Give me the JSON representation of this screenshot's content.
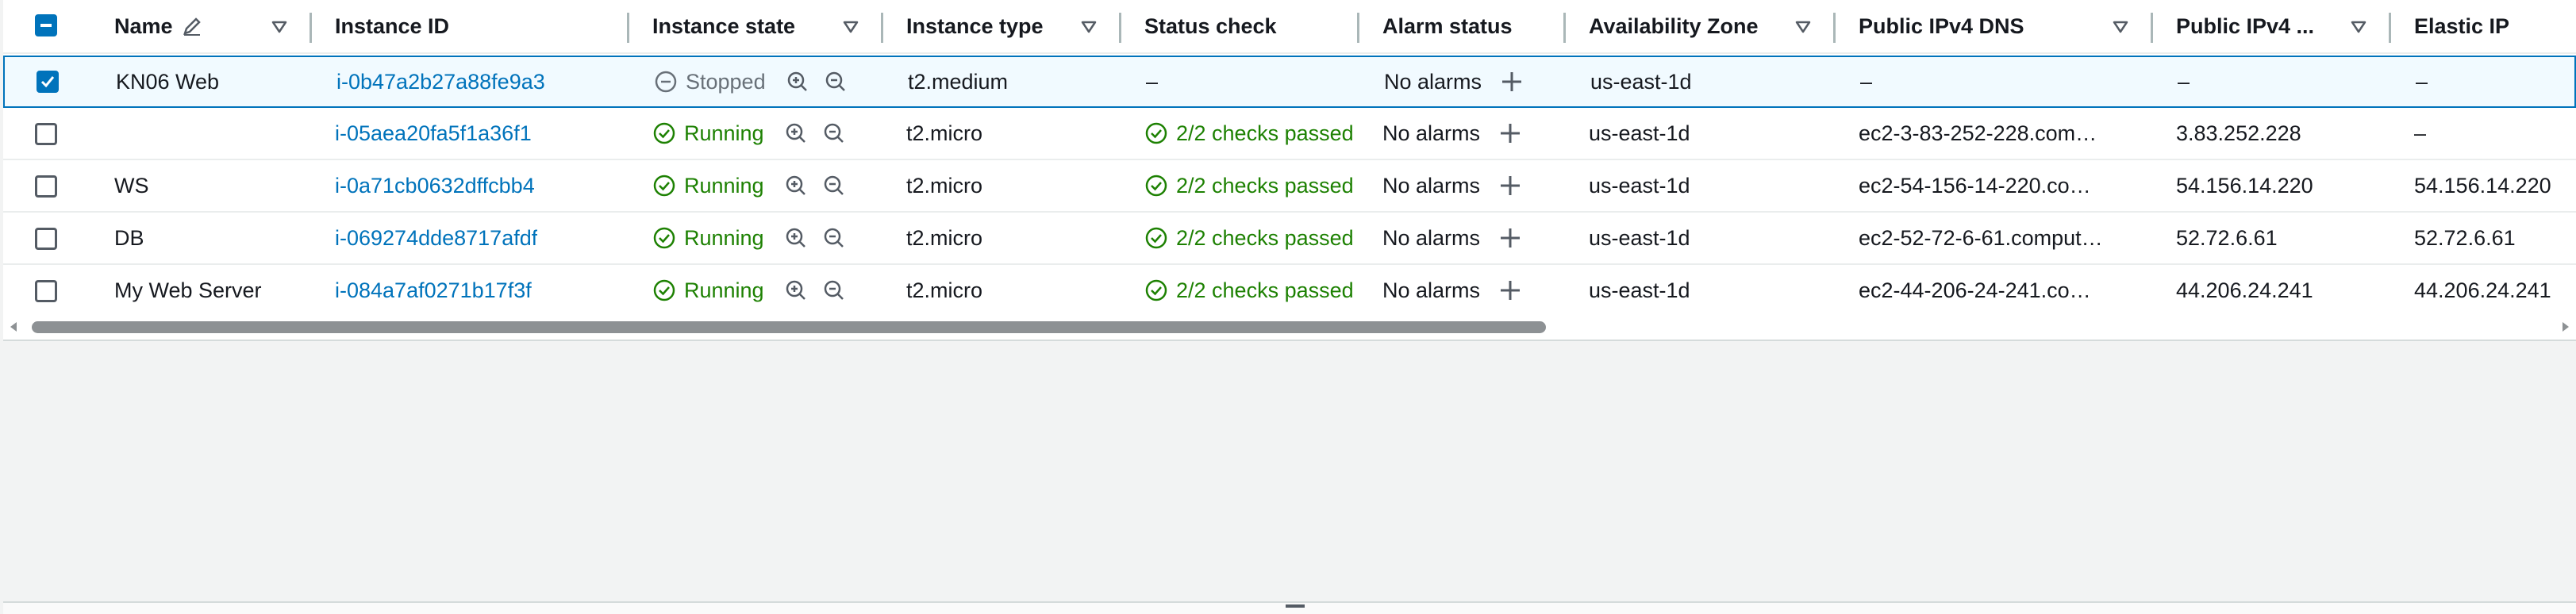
{
  "columns": [
    {
      "label": "Name",
      "edit_icon": "pencil-icon"
    },
    {
      "label": "Instance ID"
    },
    {
      "label": "Instance state"
    },
    {
      "label": "Instance type"
    },
    {
      "label": "Status check"
    },
    {
      "label": "Alarm status"
    },
    {
      "label": "Availability Zone"
    },
    {
      "label": "Public IPv4 DNS"
    },
    {
      "label": "Public IPv4 ..."
    },
    {
      "label": "Elastic IP"
    }
  ],
  "rows": [
    {
      "name": "KN06 Web",
      "id": "i-0b47a2b27a88fe9a3",
      "state": "Stopped",
      "type": "t2.medium",
      "status": "–",
      "alarm": "No alarms",
      "az": "us-east-1d",
      "dns": "–",
      "ipv4": "–",
      "eip": "–",
      "selected": true
    },
    {
      "name": "",
      "id": "i-05aea20fa5f1a36f1",
      "state": "Running",
      "type": "t2.micro",
      "status": "2/2 checks passed",
      "alarm": "No alarms",
      "az": "us-east-1d",
      "dns": "ec2-3-83-252-228.com…",
      "ipv4": "3.83.252.228",
      "eip": "–",
      "selected": false
    },
    {
      "name": "WS",
      "id": "i-0a71cb0632dffcbb4",
      "state": "Running",
      "type": "t2.micro",
      "status": "2/2 checks passed",
      "alarm": "No alarms",
      "az": "us-east-1d",
      "dns": "ec2-54-156-14-220.co…",
      "ipv4": "54.156.14.220",
      "eip": "54.156.14.220",
      "selected": false
    },
    {
      "name": "DB",
      "id": "i-069274dde8717afdf",
      "state": "Running",
      "type": "t2.micro",
      "status": "2/2 checks passed",
      "alarm": "No alarms",
      "az": "us-east-1d",
      "dns": "ec2-52-72-6-61.comput…",
      "ipv4": "52.72.6.61",
      "eip": "52.72.6.61",
      "selected": false
    },
    {
      "name": "My Web Server",
      "id": "i-084a7af0271b17f3f",
      "state": "Running",
      "type": "t2.micro",
      "status": "2/2 checks passed",
      "alarm": "No alarms",
      "az": "us-east-1d",
      "dns": "ec2-44-206-24-241.co…",
      "ipv4": "44.206.24.241",
      "eip": "44.206.24.241",
      "selected": false
    }
  ],
  "colors": {
    "link": "#0073bb",
    "running": "#1d8102",
    "stopped": "#687078",
    "selection": "#0073bb"
  }
}
